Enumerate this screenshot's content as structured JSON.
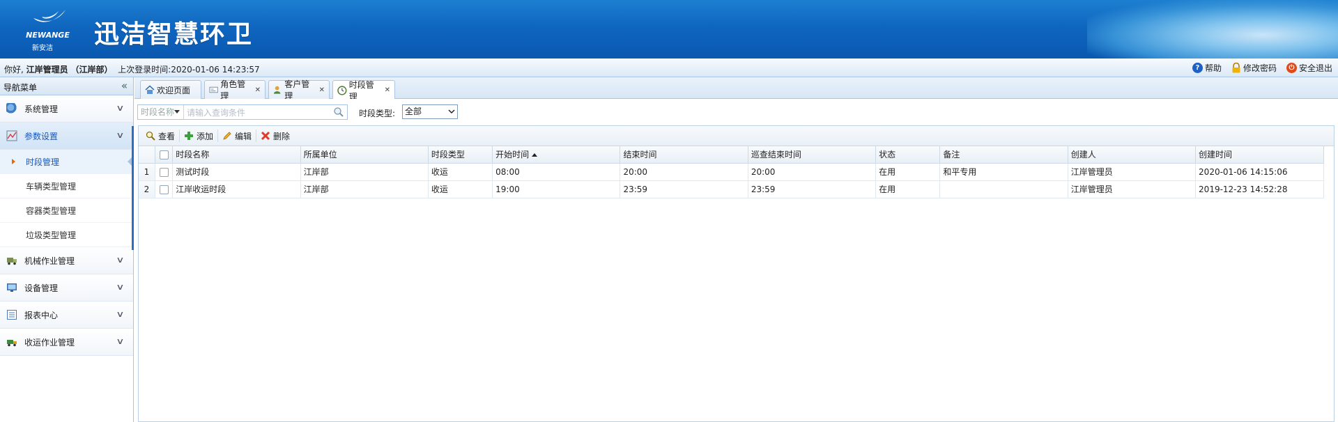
{
  "header": {
    "logo_en": "NEWANGE",
    "logo_cn": "新安洁",
    "app_title": "迅洁智慧环卫"
  },
  "userbar": {
    "greet_prefix": "你好,",
    "user_name": "江岸管理员",
    "dept": "（江岸部）",
    "last_login_label": "上次登录时间:",
    "last_login_time": "2020-01-06 14:23:57",
    "links": [
      {
        "label": "帮助",
        "icon": "help-icon",
        "color": "#1c62c4"
      },
      {
        "label": "修改密码",
        "icon": "lock-icon",
        "color": "#e3a400"
      },
      {
        "label": "安全退出",
        "icon": "power-icon",
        "color": "#e04a1a"
      }
    ]
  },
  "sidebar": {
    "title": "导航菜单",
    "collapse_icon": "«",
    "groups": [
      {
        "label": "系统管理",
        "icon": "system-gear-icon",
        "active": false
      },
      {
        "label": "参数设置",
        "icon": "params-chart-icon",
        "active": true,
        "items": [
          {
            "label": "时段管理",
            "selected": true
          },
          {
            "label": "车辆类型管理",
            "selected": false
          },
          {
            "label": "容器类型管理",
            "selected": false
          },
          {
            "label": "垃圾类型管理",
            "selected": false
          }
        ]
      },
      {
        "label": "机械作业管理",
        "icon": "truck-icon",
        "active": false
      },
      {
        "label": "设备管理",
        "icon": "monitor-icon",
        "active": false
      },
      {
        "label": "报表中心",
        "icon": "report-icon",
        "active": false
      },
      {
        "label": "收运作业管理",
        "icon": "garbage-truck-icon",
        "active": false
      }
    ]
  },
  "tabs": [
    {
      "label": "欢迎页面",
      "icon": "home-icon",
      "closable": false,
      "active": false
    },
    {
      "label": "角色管理",
      "icon": "role-card-icon",
      "closable": true,
      "active": false
    },
    {
      "label": "客户管理",
      "icon": "customer-icon",
      "closable": true,
      "active": false
    },
    {
      "label": "时段管理",
      "icon": "clock-icon",
      "closable": true,
      "active": true
    }
  ],
  "filter": {
    "search_field": "时段名称",
    "search_placeholder": "请输入查询条件",
    "type_label": "时段类型:",
    "type_value": "全部"
  },
  "toolbar": {
    "view": "查看",
    "add": "添加",
    "edit": "编辑",
    "delete": "删除"
  },
  "table": {
    "columns": [
      "时段名称",
      "所属单位",
      "时段类型",
      "开始时间",
      "结束时间",
      "巡查结束时间",
      "状态",
      "备注",
      "创建人",
      "创建时间"
    ],
    "sorted_column": "开始时间",
    "sort_dir": "asc",
    "rows": [
      {
        "n": "1",
        "cells": [
          "测试时段",
          "江岸部",
          "收运",
          "08:00",
          "20:00",
          "20:00",
          "在用",
          "和平专用",
          "江岸管理员",
          "2020-01-06 14:15:06"
        ]
      },
      {
        "n": "2",
        "cells": [
          "江岸收运时段",
          "江岸部",
          "收运",
          "19:00",
          "23:59",
          "23:59",
          "在用",
          "",
          "江岸管理员",
          "2019-12-23 14:52:28"
        ]
      }
    ]
  }
}
